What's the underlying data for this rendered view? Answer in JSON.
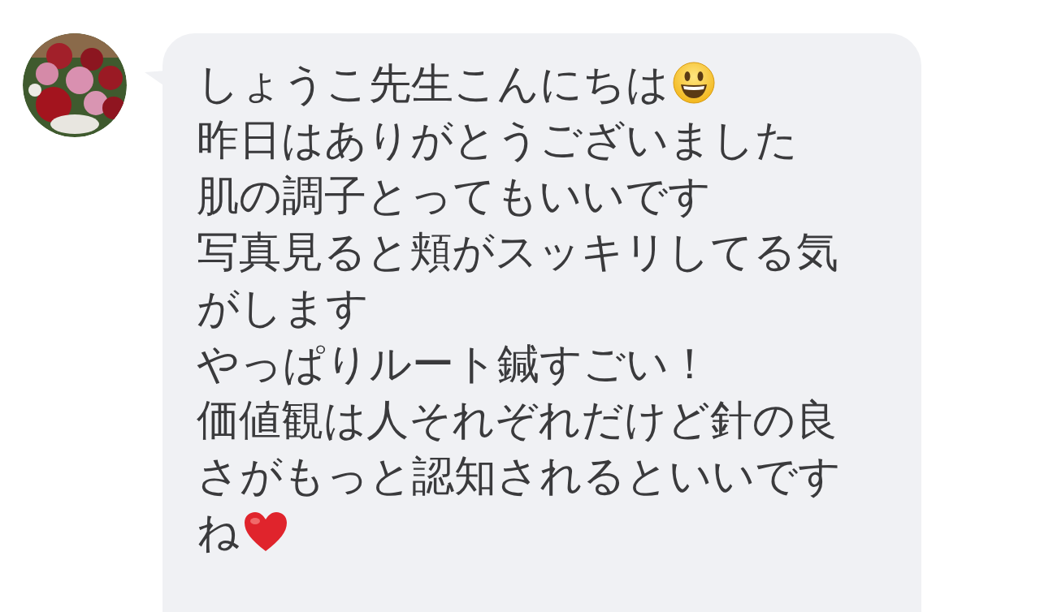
{
  "message": {
    "lines": [
      {
        "text": "しょうこ先生こんにちは",
        "kind": "smiley"
      },
      {
        "text": "昨日はありがとうございました",
        "kind": "plain"
      },
      {
        "text": "肌の調子とってもいいです",
        "kind": "plain"
      },
      {
        "text": "写真見ると頬がスッキリしてる気",
        "kind": "plain"
      },
      {
        "text": "がします",
        "kind": "plain"
      },
      {
        "text": "やっぱりルート鍼すごい！",
        "kind": "plain"
      },
      {
        "text": "価値観は人それぞれだけど針の良",
        "kind": "plain"
      },
      {
        "text": "さがもっと認知されるといいです",
        "kind": "plain"
      },
      {
        "text": "ね",
        "kind": "heart"
      }
    ]
  }
}
